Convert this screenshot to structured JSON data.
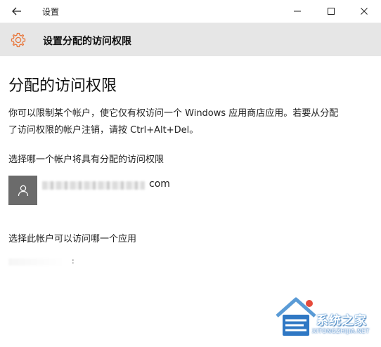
{
  "titlebar": {
    "title": "设置",
    "back_icon": "arrow-left-icon",
    "minimize_icon": "minimize-icon",
    "maximize_icon": "maximize-icon",
    "close_icon": "close-icon"
  },
  "header": {
    "icon": "gear-icon",
    "title": "设置分配的访问权限",
    "accent_color": "#e8773c",
    "background": "#e6e6e6"
  },
  "main": {
    "page_title": "分配的访问权限",
    "description": "你可以限制某个帐户，使它仅有权访问一个 Windows 应用商店应用。若要从分配了访问权限的帐户注销，请按 Ctrl+Alt+Del。",
    "account_section_label": "选择哪一个帐户将具有分配的访问权限",
    "account": {
      "avatar_icon": "user-icon",
      "email_visible_suffix": "com"
    },
    "app_section_label": "选择此帐户可以访问哪一个应用",
    "app_picker_glyph": ":"
  },
  "watermark": {
    "logo_icon": "house-logo-icon",
    "name": "系统之家",
    "site": "XITONGZHIJIA.NET"
  }
}
